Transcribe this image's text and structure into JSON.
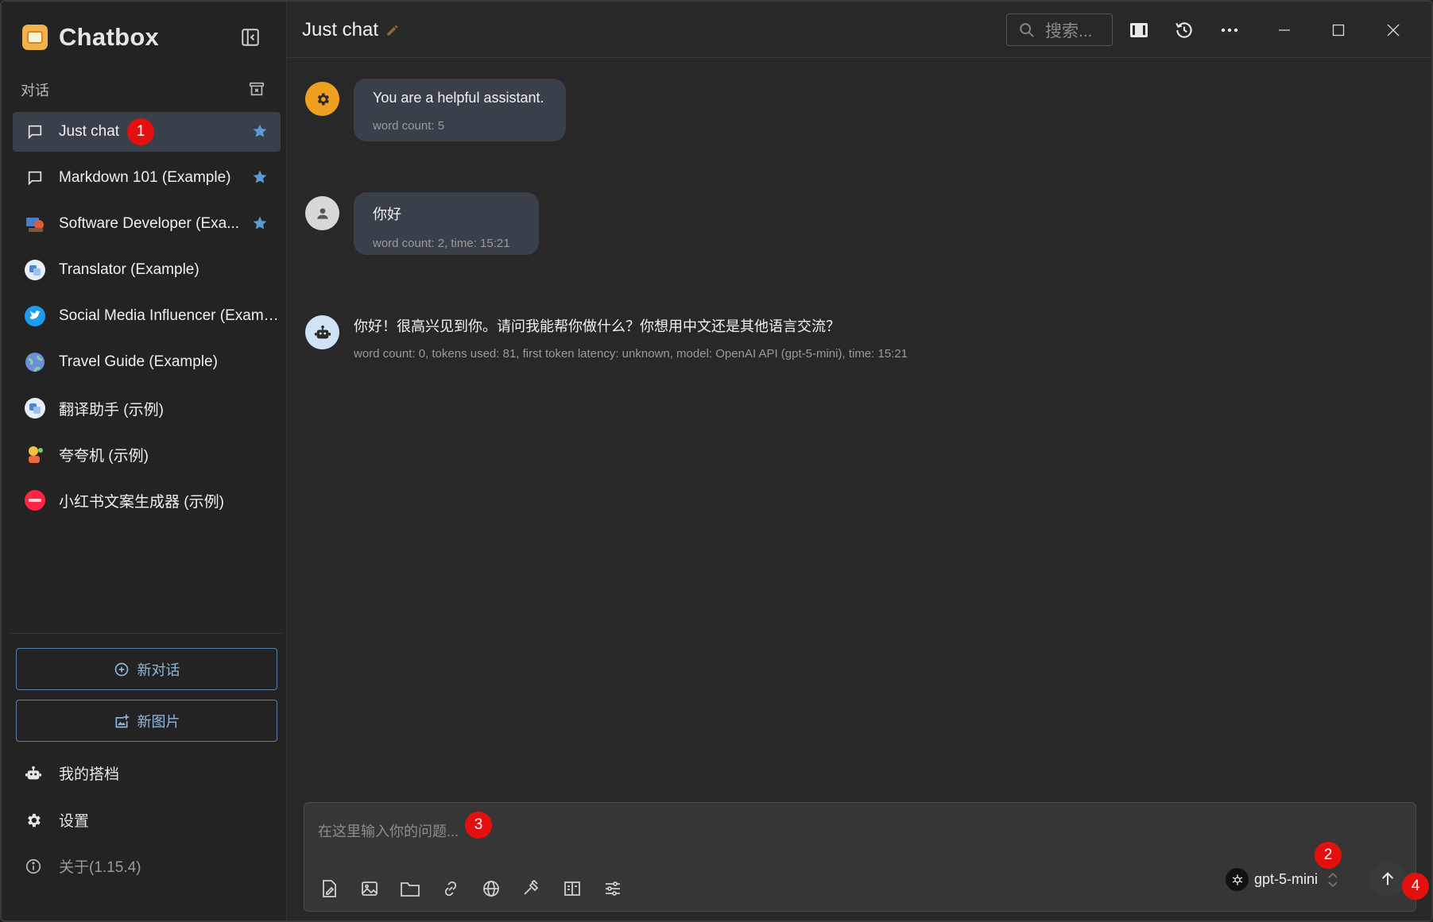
{
  "app": {
    "name": "Chatbox"
  },
  "sidebar": {
    "section_label": "对话",
    "conversations": [
      {
        "label": "Just chat",
        "icon": "chat-bubble-icon",
        "starred": true,
        "active": true
      },
      {
        "label": "Markdown 101 (Example)",
        "icon": "chat-bubble-icon",
        "starred": true
      },
      {
        "label": "Software Developer (Exa...",
        "icon": "developer-avatar",
        "starred": true
      },
      {
        "label": "Translator (Example)",
        "icon": "translator-avatar"
      },
      {
        "label": "Social Media Influencer (Examp...",
        "icon": "twitter-avatar"
      },
      {
        "label": "Travel Guide (Example)",
        "icon": "globe-avatar"
      },
      {
        "label": "翻译助手 (示例)",
        "icon": "translator-avatar"
      },
      {
        "label": "夸夸机 (示例)",
        "icon": "cheer-avatar"
      },
      {
        "label": "小红书文案生成器 (示例)",
        "icon": "xiaohongshu-avatar"
      }
    ],
    "new_chat_label": "新对话",
    "new_image_label": "新图片",
    "my_copilots_label": "我的搭档",
    "settings_label": "设置",
    "about_label": "关于(1.15.4)"
  },
  "header": {
    "title": "Just chat",
    "search_placeholder": "搜索..."
  },
  "messages": [
    {
      "role": "system",
      "text": "You are a helpful assistant.",
      "meta": "word count: 5"
    },
    {
      "role": "user",
      "text": "你好",
      "meta": "word count: 2, time: 15:21"
    },
    {
      "role": "assistant",
      "text": "你好！很高兴见到你。请问我能帮你做什么？你想用中文还是其他语言交流？",
      "meta": "word count: 0, tokens used: 81, first token latency: unknown, model: OpenAI API (gpt-5-mini), time: 15:21"
    }
  ],
  "composer": {
    "placeholder": "在这里输入你的问题...",
    "model": "gpt-5-mini"
  },
  "annotations": {
    "b1": "1",
    "b2": "2",
    "b3": "3",
    "b4": "4"
  },
  "colors": {
    "accent_blue": "#5b9bd5",
    "badge_red": "#e3100f",
    "system_avatar": "#f0a020",
    "assistant_avatar": "#cfe3f5"
  }
}
